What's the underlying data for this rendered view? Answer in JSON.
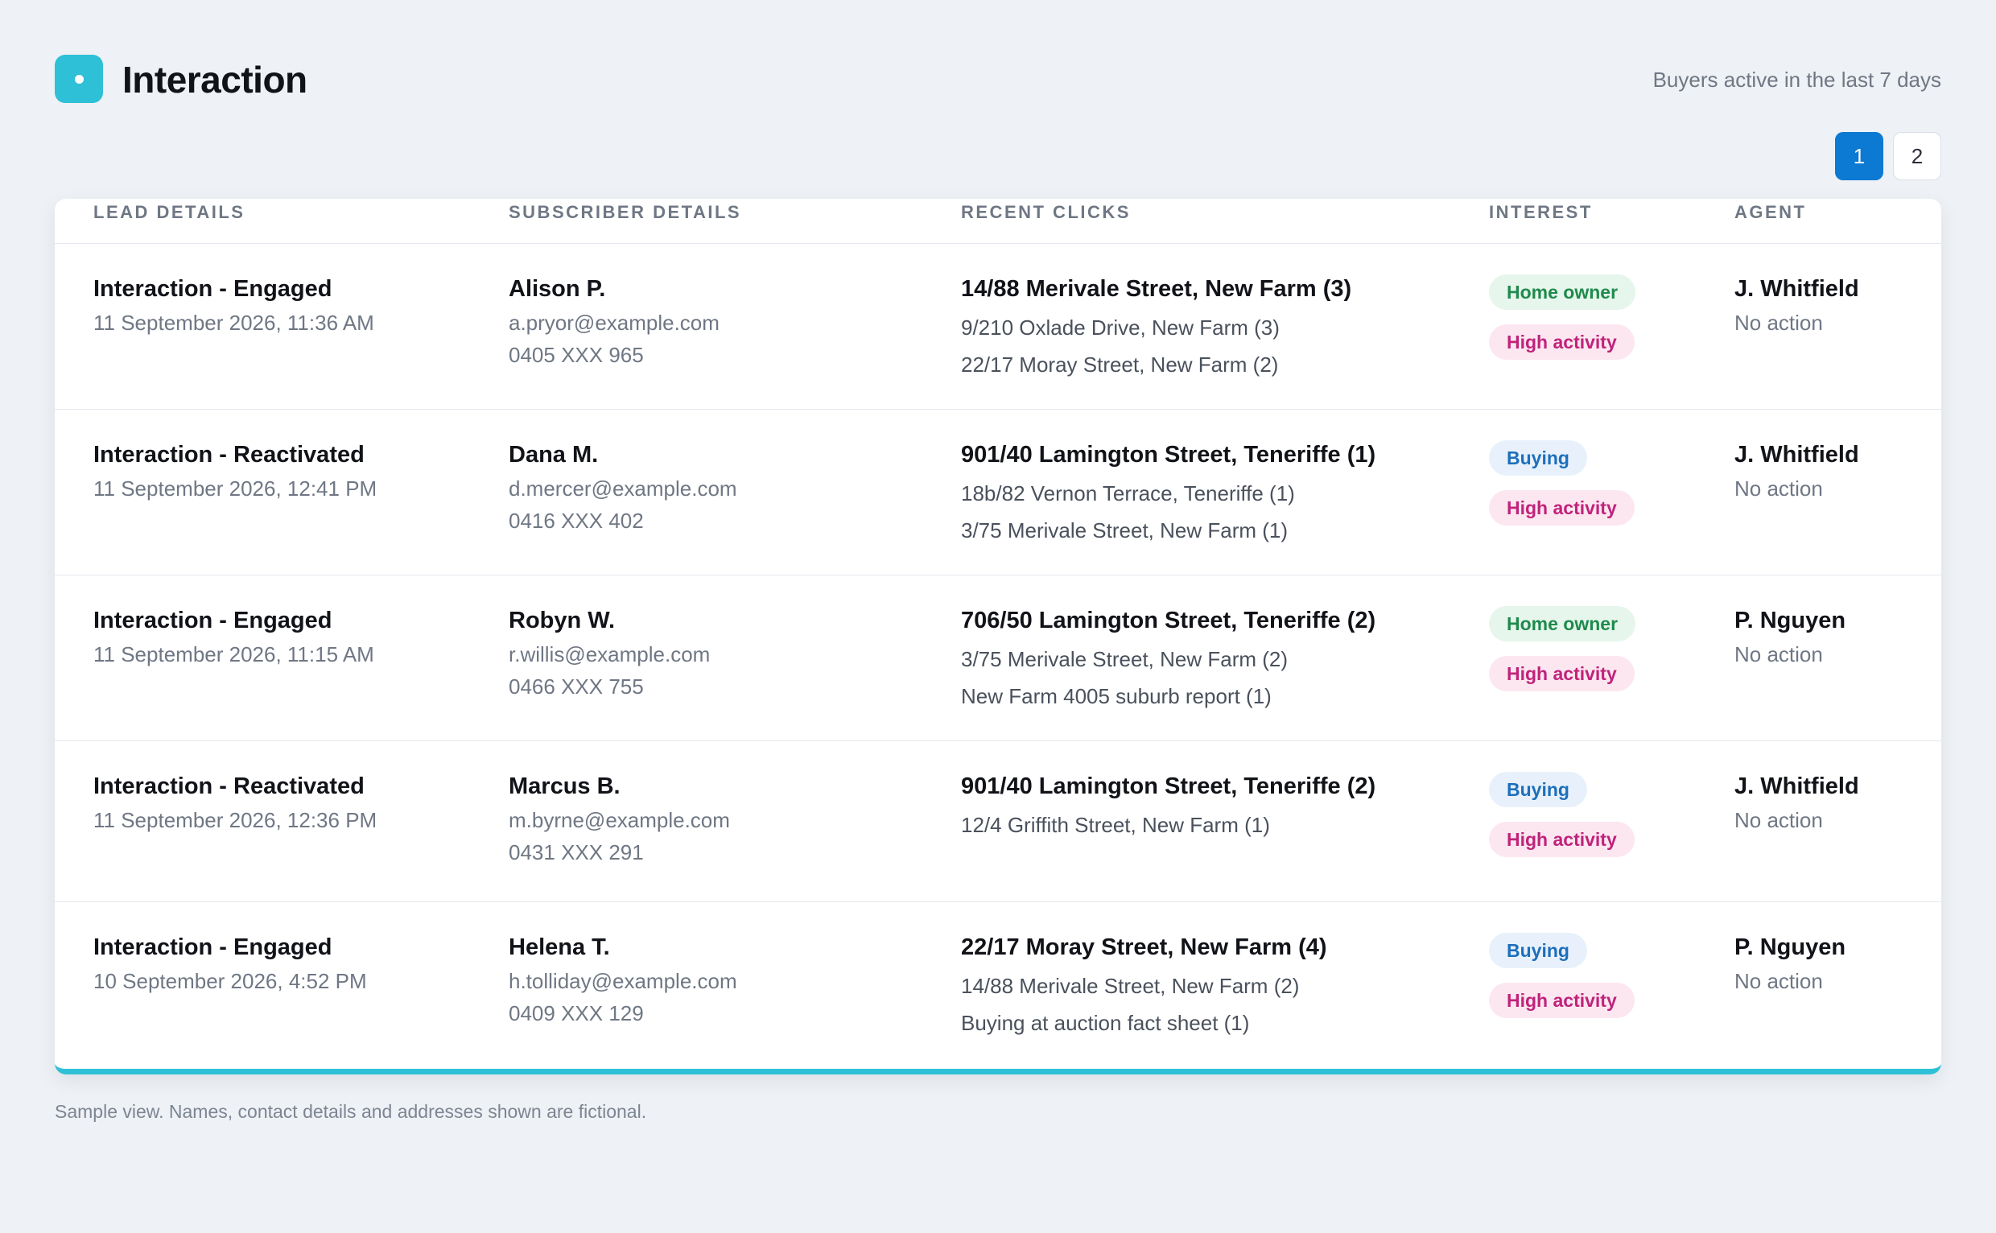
{
  "header": {
    "title": "Interaction",
    "subtitle": "Buyers active in the last 7 days"
  },
  "pager": {
    "pages": [
      "1",
      "2"
    ],
    "active": "1"
  },
  "table": {
    "columns": {
      "lead": "LEAD DETAILS",
      "subscriber": "SUBSCRIBER DETAILS",
      "clicks": "RECENT CLICKS",
      "interest": "INTEREST",
      "agent": "AGENT"
    },
    "rows": [
      {
        "lead_title": "Interaction - Engaged",
        "lead_time": "11 September 2026, 11:36 AM",
        "name": "Alison P.",
        "email": "a.pryor@example.com",
        "phone": "0405 XXX 965",
        "clicks": [
          "14/88 Merivale Street, New Farm (3)",
          "9/210 Oxlade Drive, New Farm (3)",
          "22/17 Moray Street, New Farm (2)"
        ],
        "badge1": "Home owner",
        "badge2": "High activity",
        "agent": "J. Whitfield",
        "action": "No action"
      },
      {
        "lead_title": "Interaction - Reactivated",
        "lead_time": "11 September 2026, 12:41 PM",
        "name": "Dana M.",
        "email": "d.mercer@example.com",
        "phone": "0416 XXX 402",
        "clicks": [
          "901/40 Lamington Street, Teneriffe (1)",
          "18b/82 Vernon Terrace, Teneriffe (1)",
          "3/75 Merivale Street, New Farm (1)"
        ],
        "badge1": "Buying",
        "badge2": "High activity",
        "agent": "J. Whitfield",
        "action": "No action"
      },
      {
        "lead_title": "Interaction - Engaged",
        "lead_time": "11 September 2026, 11:15 AM",
        "name": "Robyn W.",
        "email": "r.willis@example.com",
        "phone": "0466 XXX 755",
        "clicks": [
          "706/50 Lamington Street, Teneriffe (2)",
          "3/75 Merivale Street, New Farm (2)",
          "New Farm 4005 suburb report (1)"
        ],
        "badge1": "Home owner",
        "badge2": "High activity",
        "agent": "P. Nguyen",
        "action": "No action"
      },
      {
        "lead_title": "Interaction - Reactivated",
        "lead_time": "11 September 2026, 12:36 PM",
        "name": "Marcus B.",
        "email": "m.byrne@example.com",
        "phone": "0431 XXX 291",
        "clicks": [
          "901/40 Lamington Street, Teneriffe (2)",
          "12/4 Griffith Street, New Farm (1)"
        ],
        "badge1": "Buying",
        "badge2": "High activity",
        "agent": "J. Whitfield",
        "action": "No action"
      },
      {
        "lead_title": "Interaction - Engaged",
        "lead_time": "10 September 2026, 4:52 PM",
        "name": "Helena T.",
        "email": "h.tolliday@example.com",
        "phone": "0409 XXX 129",
        "clicks": [
          "22/17 Moray Street, New Farm (4)",
          "14/88 Merivale Street, New Farm (2)",
          "Buying at auction fact sheet (1)"
        ],
        "badge1": "Buying",
        "badge2": "High activity",
        "agent": "P. Nguyen",
        "action": "No action"
      }
    ]
  },
  "footnote": "Sample view. Names, contact details and addresses shown are fictional.",
  "colors": {
    "accent": "#2ec0d6",
    "pager_active": "#0c79d2",
    "home_owner": "#1f8a4c",
    "buying": "#1d6fba",
    "high_activity": "#c0237a"
  }
}
